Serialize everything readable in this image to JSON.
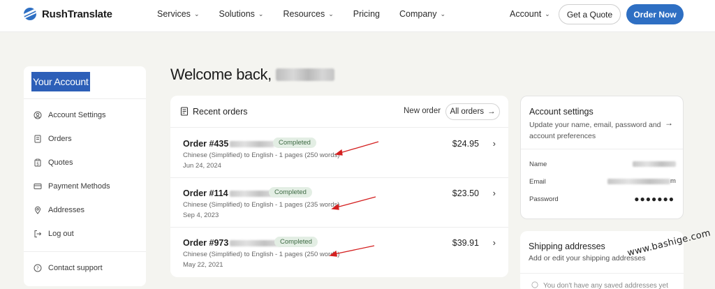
{
  "header": {
    "brand": "RushTranslate",
    "nav": [
      {
        "label": "Services",
        "dropdown": true
      },
      {
        "label": "Solutions",
        "dropdown": true
      },
      {
        "label": "Resources",
        "dropdown": true
      },
      {
        "label": "Pricing",
        "dropdown": false
      },
      {
        "label": "Company",
        "dropdown": true
      }
    ],
    "account_label": "Account",
    "quote_label": "Get a Quote",
    "order_now_label": "Order Now",
    "brand_color": "#2e6fc3"
  },
  "sidebar": {
    "title": "Your Account",
    "items": [
      {
        "label": "Account Settings",
        "icon": "user-circle-icon"
      },
      {
        "label": "Orders",
        "icon": "document-icon"
      },
      {
        "label": "Quotes",
        "icon": "clipboard-icon"
      },
      {
        "label": "Payment Methods",
        "icon": "credit-card-icon"
      },
      {
        "label": "Addresses",
        "icon": "location-pin-icon"
      },
      {
        "label": "Log out",
        "icon": "logout-icon"
      }
    ],
    "support_label": "Contact support"
  },
  "welcome": {
    "text": "Welcome back,"
  },
  "recent_orders": {
    "title": "Recent orders",
    "new_order_label": "New order",
    "all_orders_label": "All orders",
    "orders": [
      {
        "number": "Order #435",
        "status": "Completed",
        "description": "Chinese (Simplified) to English - 1 pages (250 words)",
        "date": "Jun 24, 2024",
        "price": "$24.95"
      },
      {
        "number": "Order #114",
        "status": "Completed",
        "description": "Chinese (Simplified) to English - 1 pages (235 words)",
        "date": "Sep 4, 2023",
        "price": "$23.50"
      },
      {
        "number": "Order #973",
        "status": "Completed",
        "description": "Chinese (Simplified) to English - 1 pages (250 words)",
        "date": "May 22, 2021",
        "price": "$39.91"
      }
    ]
  },
  "account_settings": {
    "title": "Account settings",
    "subtitle": "Update your name, email, password and account preferences",
    "name_label": "Name",
    "email_label": "Email",
    "email_tail": "m",
    "password_label": "Password",
    "password_value": "●●●●●●●"
  },
  "shipping": {
    "title": "Shipping addresses",
    "subtitle": "Add or edit your shipping addresses",
    "empty_text": "You don't have any saved addresses yet"
  },
  "watermark": "www.bashige.com"
}
